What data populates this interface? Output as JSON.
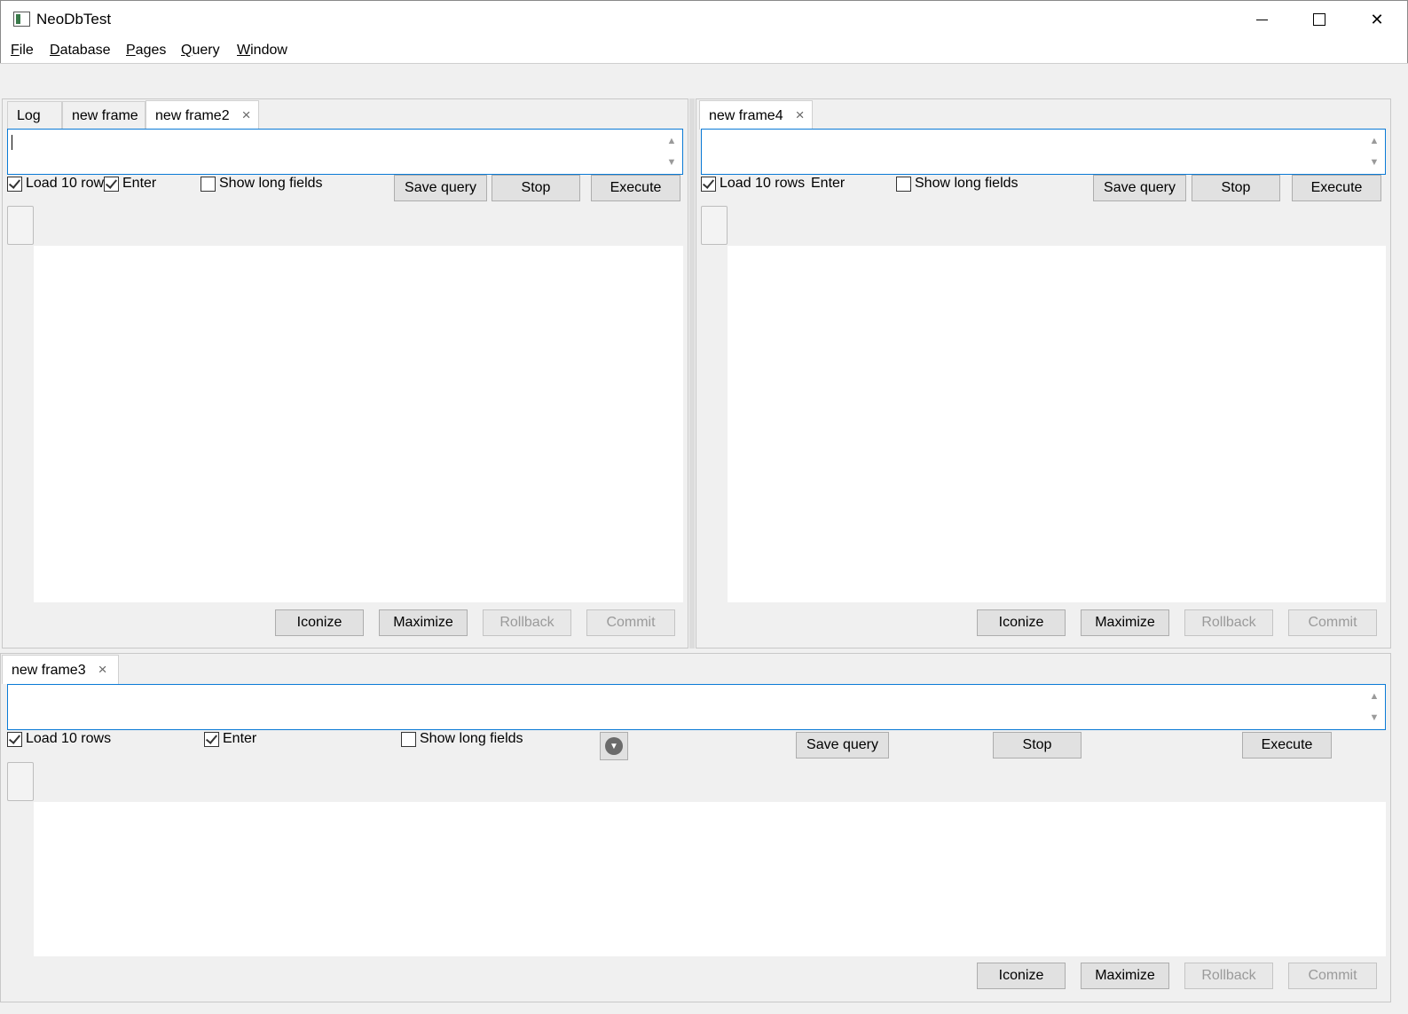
{
  "window": {
    "title": "NeoDbTest"
  },
  "menu": [
    {
      "mnemonic": "F",
      "rest": "ile"
    },
    {
      "mnemonic": "D",
      "rest": "atabase"
    },
    {
      "mnemonic": "P",
      "rest": "ages"
    },
    {
      "mnemonic": "Q",
      "rest": "uery"
    },
    {
      "mnemonic": "W",
      "rest": "indow"
    }
  ],
  "pane_left": {
    "tabs": [
      {
        "label": "Log",
        "active": false
      },
      {
        "label": "new frame",
        "active": false
      },
      {
        "label": "new frame2",
        "active": true,
        "close": "×"
      }
    ],
    "load_rows": "Load 10 row",
    "load_rows_checked": true,
    "enter": "Enter",
    "enter_checked": true,
    "show_long": "Show long fields",
    "show_long_checked": false,
    "save_query": "Save query",
    "stop": "Stop",
    "execute": "Execute",
    "iconize": "Iconize",
    "maximize": "Maximize",
    "rollback": "Rollback",
    "commit": "Commit"
  },
  "pane_right": {
    "tabs": [
      {
        "label": "new frame4",
        "active": true,
        "close": "×"
      }
    ],
    "load_rows": "Load 10 rows",
    "load_rows_checked": true,
    "enter": "Enter",
    "enter_checked": true,
    "show_long": "Show long fields",
    "show_long_checked": false,
    "save_query": "Save query",
    "stop": "Stop",
    "execute": "Execute",
    "iconize": "Iconize",
    "maximize": "Maximize",
    "rollback": "Rollback",
    "commit": "Commit"
  },
  "pane_bottom": {
    "tabs": [
      {
        "label": "new frame3",
        "active": true,
        "close": "×"
      }
    ],
    "load_rows": "Load 10 rows",
    "load_rows_checked": true,
    "enter": "Enter",
    "enter_checked": true,
    "show_long": "Show long fields",
    "show_long_checked": false,
    "save_query": "Save query",
    "stop": "Stop",
    "execute": "Execute",
    "iconize": "Iconize",
    "maximize": "Maximize",
    "rollback": "Rollback",
    "commit": "Commit"
  },
  "icons": {
    "window_close": "close-icon",
    "tab_close": "close-icon",
    "dropdown": "chevron-down-icon",
    "scroll_up": "chevron-up-icon",
    "scroll_down": "chevron-down-icon"
  },
  "colors": {
    "accent": "#0a7ad6",
    "disabled_text": "#9a9a9a"
  }
}
